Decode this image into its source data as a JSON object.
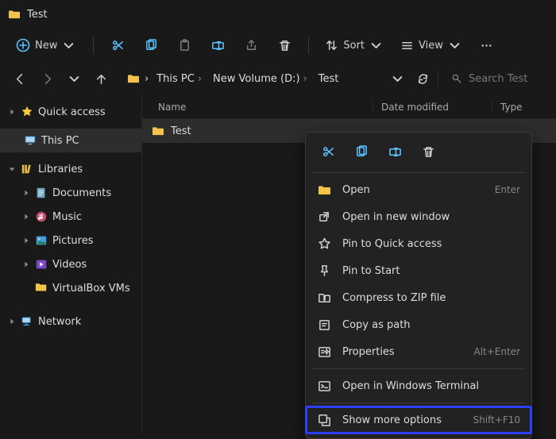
{
  "title": "Test",
  "toolbar": {
    "new_label": "New",
    "sort_label": "Sort",
    "view_label": "View"
  },
  "breadcrumbs": {
    "root": "This PC",
    "mid": "New Volume (D:)",
    "leaf": "Test"
  },
  "search": {
    "placeholder": "Search Test"
  },
  "sidebar": {
    "quick_access": "Quick access",
    "this_pc": "This PC",
    "libraries": "Libraries",
    "lib_items": {
      "documents": "Documents",
      "music": "Music",
      "pictures": "Pictures",
      "videos": "Videos",
      "vbox": "VirtualBox VMs"
    },
    "network": "Network"
  },
  "columns": {
    "name": "Name",
    "date": "Date modified",
    "type": "Type"
  },
  "rows": {
    "r0": {
      "name": "Test"
    }
  },
  "context": {
    "open": "Open",
    "open_accel": "Enter",
    "open_new": "Open in new window",
    "pin_quick": "Pin to Quick access",
    "pin_start": "Pin to Start",
    "zip": "Compress to ZIP file",
    "copy_path": "Copy as path",
    "properties": "Properties",
    "properties_accel": "Alt+Enter",
    "terminal": "Open in Windows Terminal",
    "more": "Show more options",
    "more_accel": "Shift+F10"
  }
}
